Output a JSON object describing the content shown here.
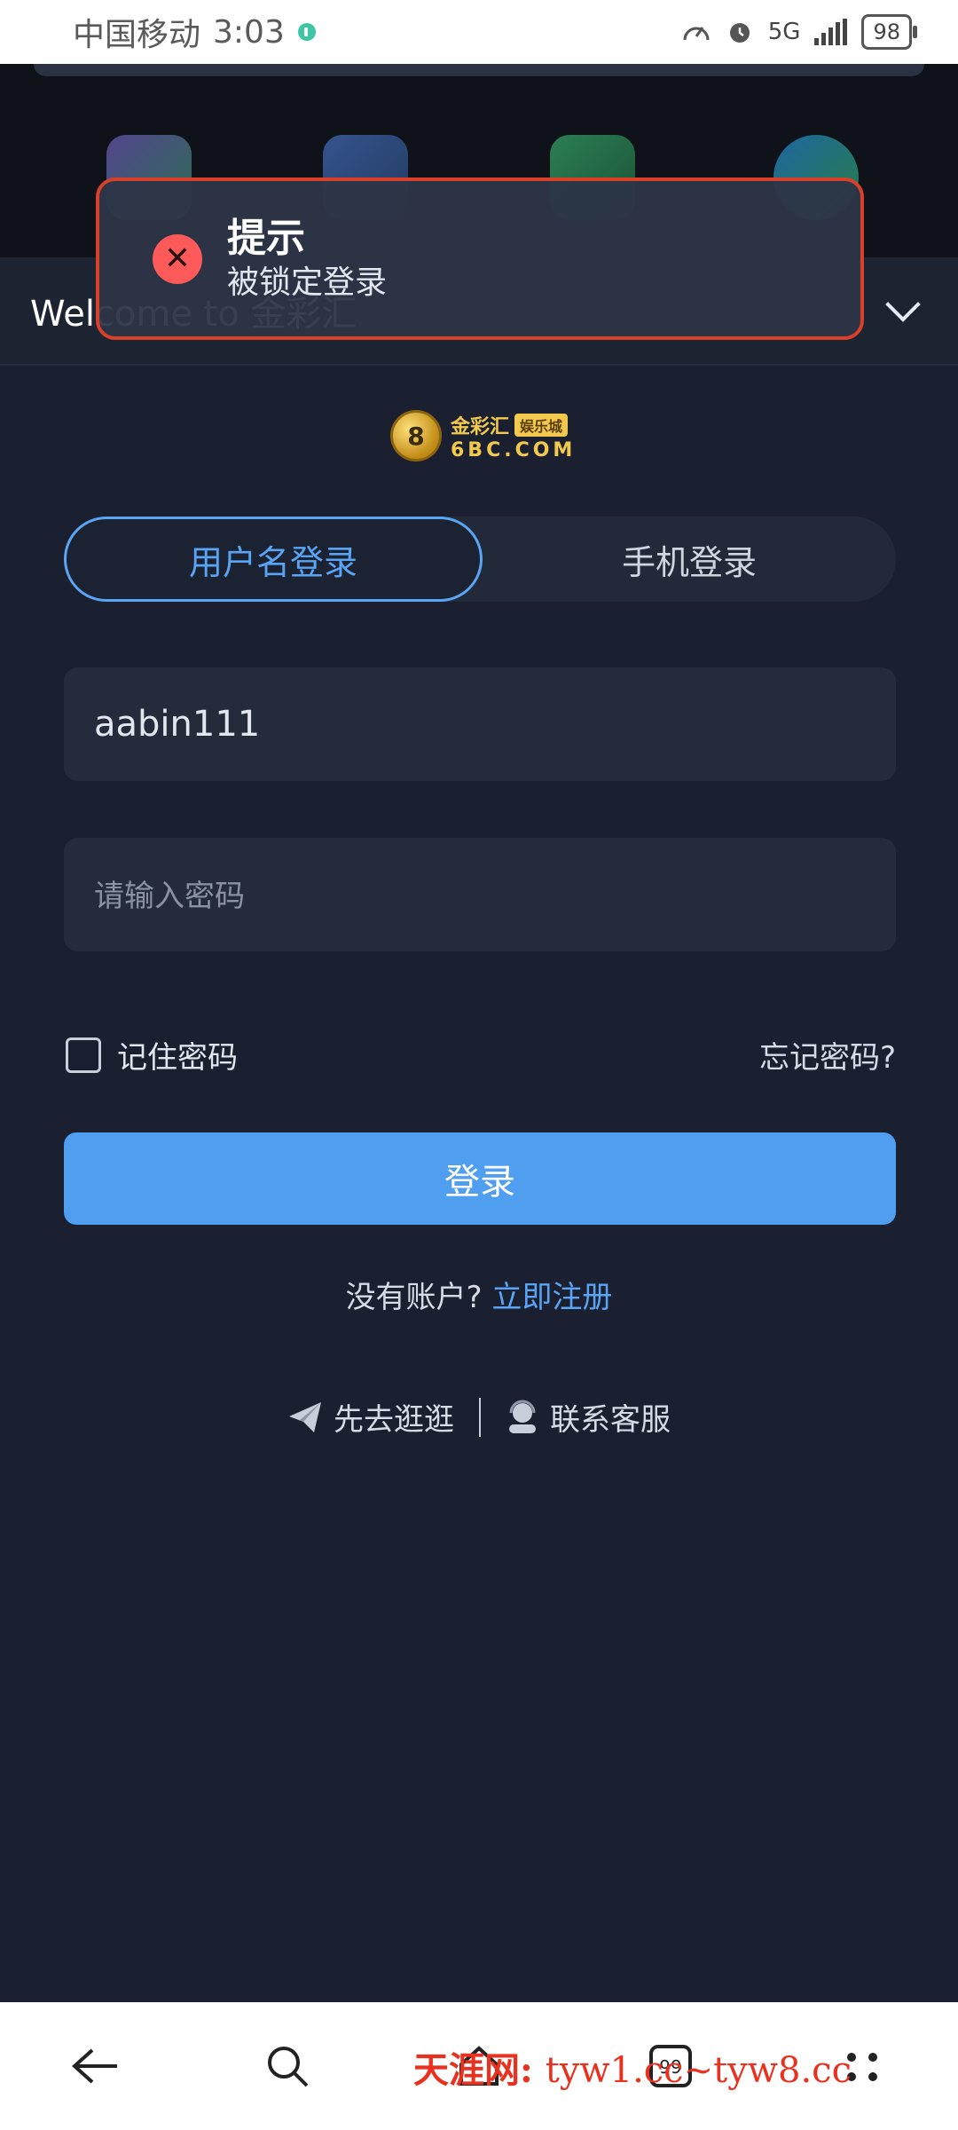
{
  "status_bar": {
    "carrier": "中国移动",
    "time": "3:03",
    "network": "5G",
    "battery": "98"
  },
  "header": {
    "welcome_text": "Welcome to 金彩汇"
  },
  "toast": {
    "title": "提示",
    "message": "被锁定登录",
    "accent_color": "#d8402a",
    "icon": "close-icon"
  },
  "logo": {
    "brand_name": "金彩汇",
    "tag": "娱乐城",
    "domain": "6BC.COM"
  },
  "tabs": [
    {
      "label": "用户名登录",
      "active": true
    },
    {
      "label": "手机登录",
      "active": false
    }
  ],
  "form": {
    "username_value": "aabin111",
    "password_placeholder": "请输入密码",
    "remember_label": "记住密码",
    "forgot_label": "忘记密码?",
    "login_label": "登录"
  },
  "register": {
    "prompt": "没有账户?",
    "link": "立即注册"
  },
  "links": {
    "browse": "先去逛逛",
    "support": "联系客服"
  },
  "watermark": {
    "site_name": "天涯网:",
    "domains": "tyw1.cc~tyw8.cc"
  },
  "colors": {
    "accent": "#4f9ef0",
    "background": "#1a2030",
    "error": "#ff5a5a"
  }
}
